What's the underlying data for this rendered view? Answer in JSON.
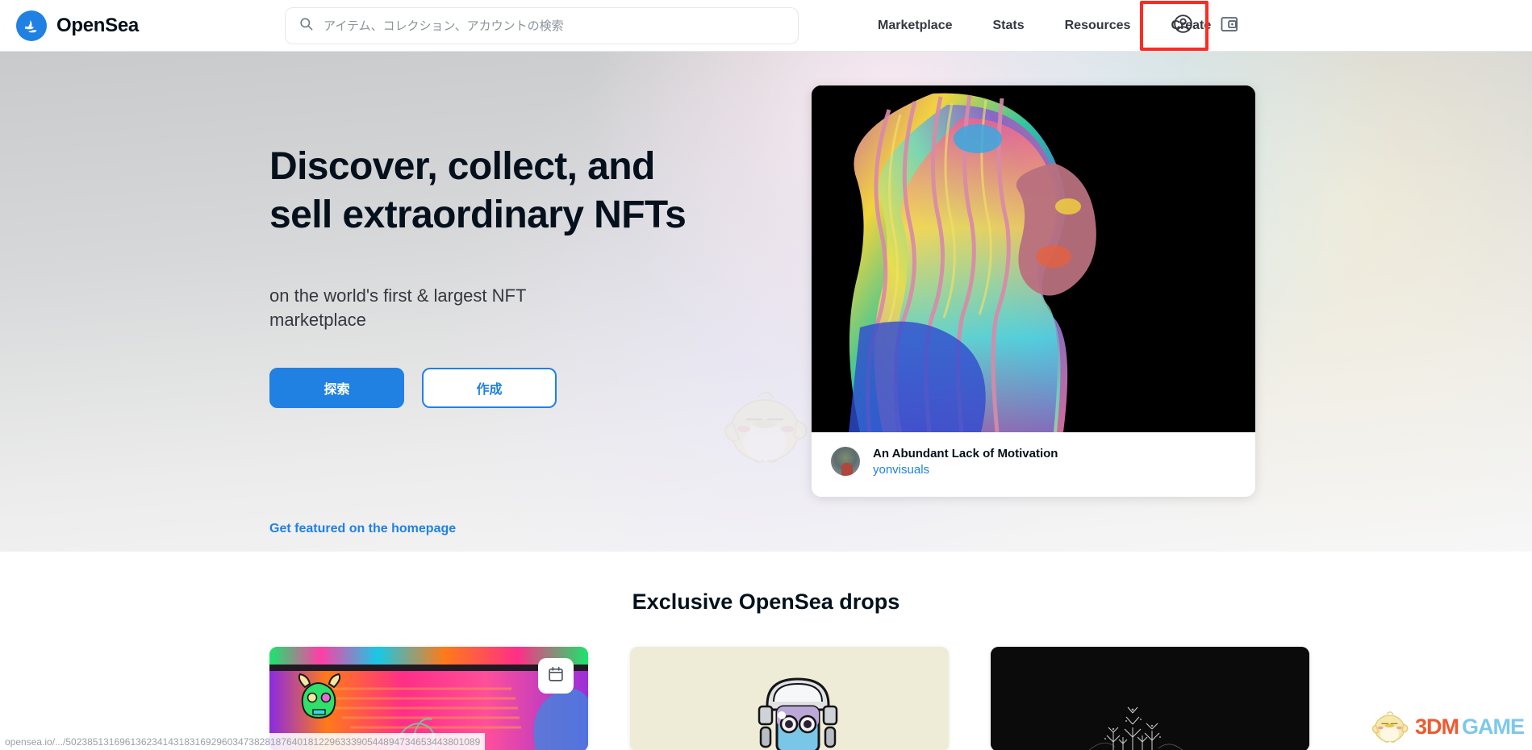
{
  "header": {
    "brand_name": "OpenSea",
    "brand_icon": "opensea-logo-icon",
    "search": {
      "placeholder": "アイテム、コレクション、アカウントの検索",
      "value": "",
      "icon": "search-icon"
    },
    "nav_items": [
      {
        "label": "Marketplace"
      },
      {
        "label": "Stats"
      },
      {
        "label": "Resources"
      },
      {
        "label": "Create"
      }
    ],
    "account_icon": "account-circle-icon",
    "wallet_icon": "wallet-icon",
    "highlight_color": "#ff2a21",
    "highlight_target": "account-circle-icon"
  },
  "hero": {
    "title": "Discover, collect, and sell extraordinary NFTs",
    "subtitle": "on the world's first & largest NFT marketplace",
    "primary_button": "探索",
    "secondary_button": "作成",
    "featured_link": "Get featured on the homepage",
    "mascot_icon": "chick-mascot-icon",
    "card": {
      "title": "An Abundant Lack of Motivation",
      "creator": "yonvisuals",
      "artwork_icon": "psychedelic-portrait-artwork"
    }
  },
  "drops": {
    "heading": "Exclusive OpenSea drops",
    "cards": [
      {
        "name": "neon-skull-drop",
        "badge_icon": "calendar-icon"
      },
      {
        "name": "robot-head-drop",
        "badge_icon": ""
      },
      {
        "name": "dark-fractal-drop",
        "badge_icon": ""
      }
    ]
  },
  "statusbar": {
    "url": "opensea.io/.../50238513169613623414318316929603473828187640181229633390544894734653443801089"
  },
  "watermark": {
    "text_primary": "3DM",
    "text_secondary": "GAME",
    "mascot_icon": "chick-mascot-icon",
    "color_primary": "#ef5a31",
    "color_secondary": "#7ec8ea"
  },
  "colors": {
    "accent": "#2081e2",
    "text": "#04111d",
    "muted": "#707a83",
    "highlight": "#ff2a21"
  }
}
